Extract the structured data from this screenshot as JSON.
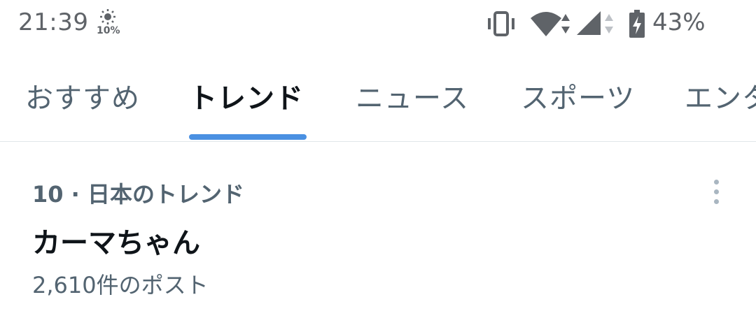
{
  "status_bar": {
    "time": "21:39",
    "brightness_level": "10%",
    "battery_percent": "43%",
    "icons": [
      "brightness-icon",
      "vibrate-icon",
      "wifi-icon",
      "cell-signal-icon",
      "battery-charging-icon"
    ]
  },
  "tabs": [
    {
      "label": "おすすめ",
      "active": false
    },
    {
      "label": "トレンド",
      "active": true
    },
    {
      "label": "ニュース",
      "active": false
    },
    {
      "label": "スポーツ",
      "active": false
    },
    {
      "label": "エンタ",
      "active": false
    }
  ],
  "trend": {
    "meta": "10 · 日本のトレンド",
    "title": "カーマちゃん",
    "post_count": "2,610件のポスト",
    "more_icon": "more-vertical-icon"
  },
  "colors": {
    "accent": "#1d9bf0",
    "active_text": "#0f1419",
    "secondary_text": "#536471",
    "divider": "#e1e6ea",
    "status_text": "#5f6368"
  }
}
